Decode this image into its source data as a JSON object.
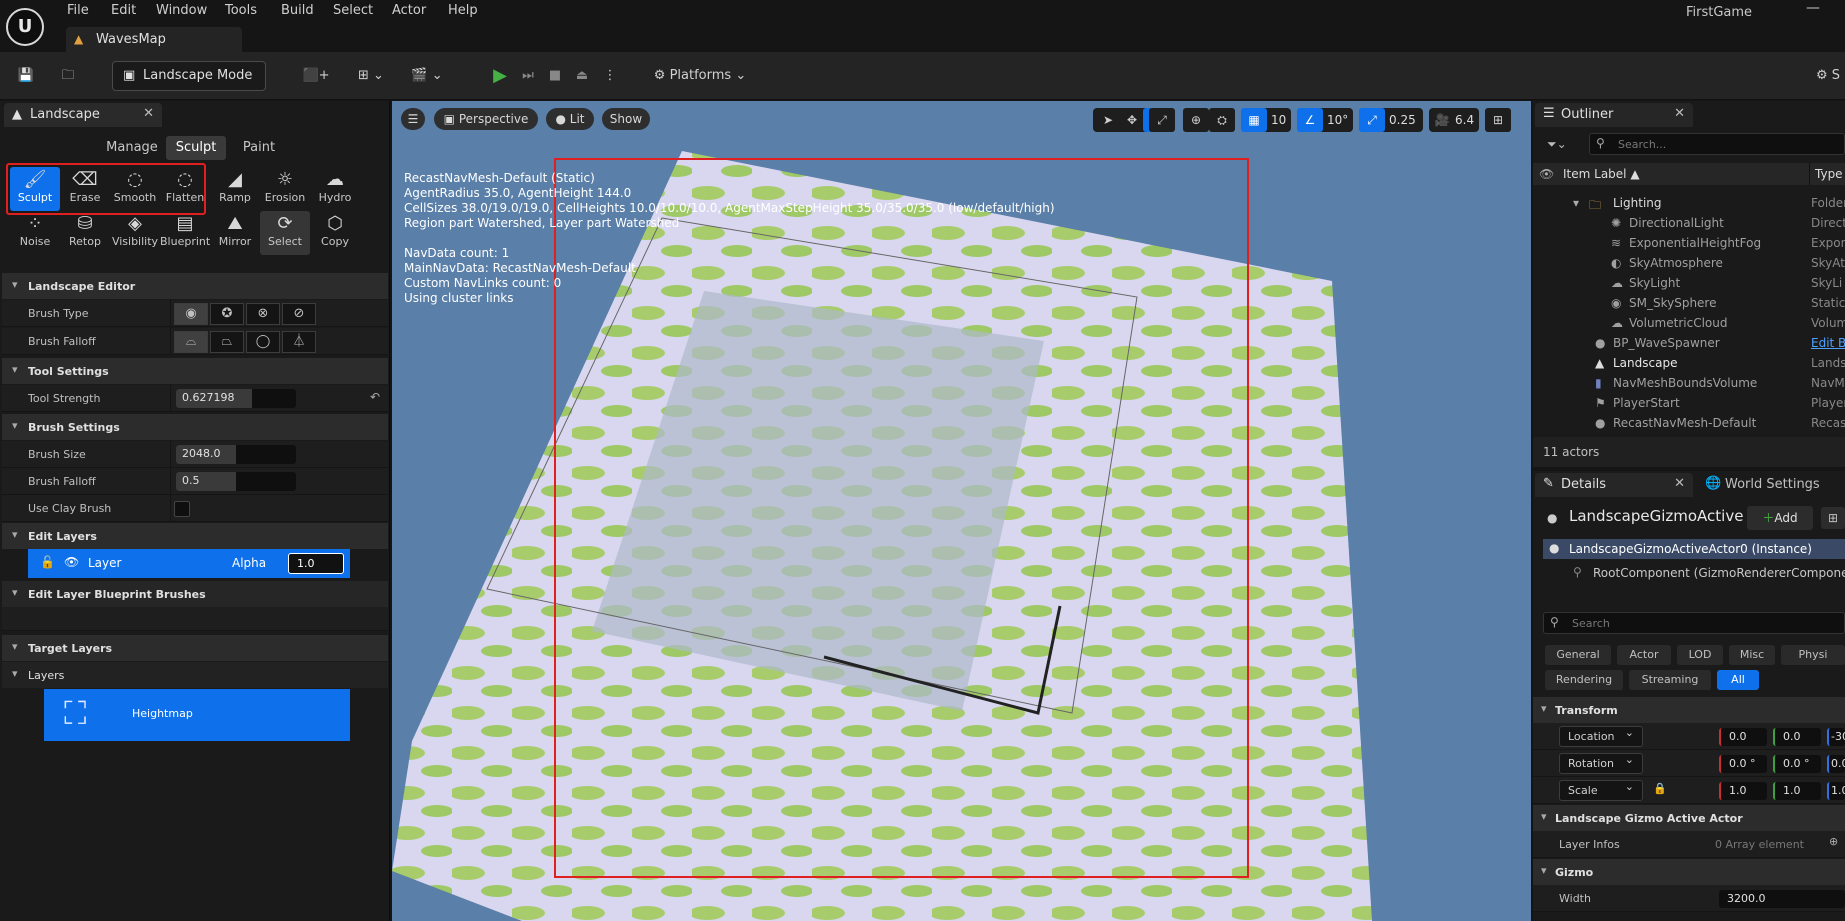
{
  "app": {
    "project": "FirstGame",
    "map_tab": "WavesMap",
    "minimize": "—"
  },
  "menu": [
    "File",
    "Edit",
    "Window",
    "Tools",
    "Build",
    "Select",
    "Actor",
    "Help"
  ],
  "toolbar": {
    "mode": "Landscape Mode",
    "platforms": "Platforms",
    "settings_partial": "S"
  },
  "landscape_panel": {
    "tab": "Landscape",
    "modes": [
      "Manage",
      "Sculpt",
      "Paint"
    ],
    "active_mode": "Sculpt",
    "tools_row1": [
      "Sculpt",
      "Erase",
      "Smooth",
      "Flatten",
      "Ramp",
      "Erosion",
      "Hydro"
    ],
    "tools_row2": [
      "Noise",
      "Retop",
      "Visibility",
      "Blueprint",
      "Mirror",
      "Select",
      "Copy"
    ],
    "landscape_editor": "Landscape Editor",
    "brush_type_label": "Brush Type",
    "brush_falloff_label": "Brush Falloff",
    "tool_settings": "Tool Settings",
    "tool_strength_label": "Tool Strength",
    "tool_strength_value": "0.627198",
    "tool_strength_fraction": 0.63,
    "brush_settings": "Brush Settings",
    "brush_size_label": "Brush Size",
    "brush_size_value": "2048.0",
    "brush_size_fraction": 0.5,
    "brush_falloff2_label": "Brush Falloff",
    "brush_falloff2_value": "0.5",
    "brush_falloff2_fraction": 0.5,
    "clay_label": "Use Clay Brush",
    "edit_layers": "Edit Layers",
    "layer_name": "Layer",
    "alpha_label": "Alpha",
    "alpha_value": "1.0",
    "edit_layer_bp": "Edit Layer Blueprint Brushes",
    "target_layers": "Target Layers",
    "layers": "Layers",
    "heightmap": "Heightmap"
  },
  "viewport": {
    "perspective": "Perspective",
    "lit": "Lit",
    "show": "Show",
    "grid_snap": "10",
    "rot_snap": "10°",
    "scale_snap": "0.25",
    "cam_speed": "6.4",
    "stats": [
      "RecastNavMesh-Default (Static)",
      "AgentRadius 35.0, AgentHeight 144.0",
      "CellSizes 38.0/19.0/19.0, CellHeights 10.0/10.0/10.0, AgentMaxStepHeight 35.0/35.0/35.0 (low/default/high)",
      "Region part Watershed, Layer part Watershed",
      "",
      "NavData count: 1",
      "MainNavData: RecastNavMesh-Default",
      "Custom NavLinks count: 0",
      "Using cluster links"
    ]
  },
  "outliner": {
    "tab": "Outliner",
    "search_placeholder": "Search...",
    "col_label": "Item Label ▲",
    "col_type": "Type",
    "rows": [
      {
        "name": "Lighting",
        "type": "Folder"
      },
      {
        "name": "DirectionalLight",
        "type": "Direct"
      },
      {
        "name": "ExponentialHeightFog",
        "type": "Expon"
      },
      {
        "name": "SkyAtmosphere",
        "type": "SkyAt"
      },
      {
        "name": "SkyLight",
        "type": "SkyLi"
      },
      {
        "name": "SM_SkySphere",
        "type": "Static"
      },
      {
        "name": "VolumetricCloud",
        "type": "Volum"
      },
      {
        "name": "BP_WaveSpawner",
        "type": "Edit B"
      },
      {
        "name": "Landscape",
        "type": "Lands"
      },
      {
        "name": "NavMeshBoundsVolume",
        "type": "NavM"
      },
      {
        "name": "PlayerStart",
        "type": "Player"
      },
      {
        "name": "RecastNavMesh-Default",
        "type": "Recas"
      }
    ],
    "count": "11 actors"
  },
  "details": {
    "tab": "Details",
    "world_settings": "World Settings",
    "actor_name": "LandscapeGizmoActiveA",
    "add": "Add",
    "instance": "LandscapeGizmoActiveActor0 (Instance)",
    "component": "RootComponent (GizmoRendererComponen",
    "search_placeholder": "Search",
    "filters_row1": [
      "General",
      "Actor",
      "LOD",
      "Misc",
      "Physi"
    ],
    "filters_row2": [
      "Rendering",
      "Streaming",
      "All"
    ],
    "transform": "Transform",
    "location": "Location",
    "location_vals": [
      "0.0",
      "0.0",
      "-30"
    ],
    "rotation": "Rotation",
    "rotation_vals": [
      "0.0 °",
      "0.0 °",
      "0.0"
    ],
    "scale": "Scale",
    "scale_vals": [
      "1.0",
      "1.0",
      "1.0"
    ],
    "gizmo_section": "Landscape Gizmo Active Actor",
    "layer_infos": "Layer Infos",
    "layer_infos_val": "0 Array element",
    "gizmo": "Gizmo",
    "width_label": "Width",
    "width_val": "3200.0"
  },
  "colors": {
    "accent": "#0e71eb",
    "highlight": "#e02020",
    "play": "#45b043"
  }
}
